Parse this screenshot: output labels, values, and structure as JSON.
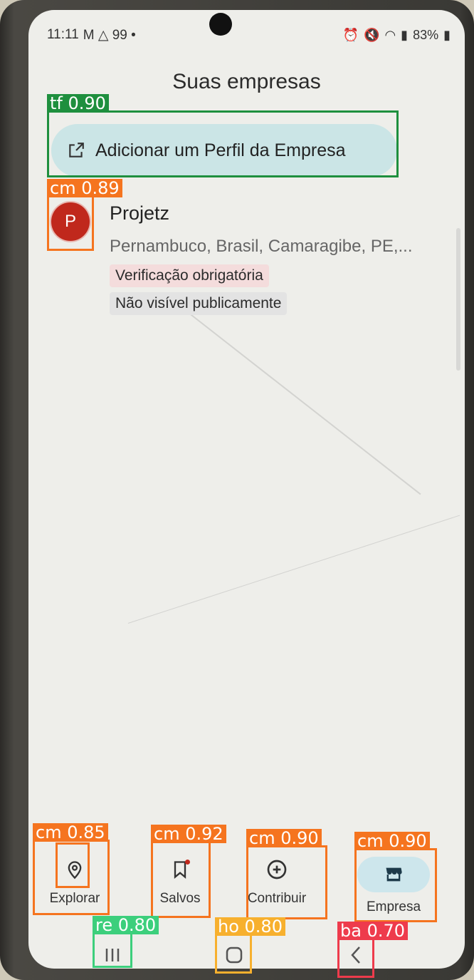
{
  "status_bar": {
    "time": "11:11",
    "left_icons": "M △ 99 •",
    "battery": "83%"
  },
  "page": {
    "title": "Suas empresas"
  },
  "add_profile_button": {
    "label": "Adicionar um Perfil da Empresa",
    "icon": "open-in-new-icon"
  },
  "business": {
    "avatar_letter": "P",
    "name": "Projetz",
    "address": "Pernambuco, Brasil, Camaragibe, PE,...",
    "chips": [
      "Verificação obrigatória",
      "Não visível publicamente"
    ]
  },
  "bottom_nav": {
    "items": [
      {
        "label": "Explorar",
        "icon": "location-pin-icon"
      },
      {
        "label": "Salvos",
        "icon": "bookmark-icon"
      },
      {
        "label": "Contribuir",
        "icon": "add-circle-icon"
      },
      {
        "label": "Empresa",
        "icon": "storefront-icon",
        "active": true
      }
    ]
  },
  "system_nav": {
    "buttons": [
      "recent-apps-icon",
      "home-icon",
      "back-icon"
    ]
  },
  "detections": [
    {
      "label": "tf 0.90",
      "color": "#1e8f3e"
    },
    {
      "label": "cm 0.89",
      "color": "#f5741f"
    },
    {
      "label": "cm 0.85",
      "color": "#f5741f"
    },
    {
      "label": "cm 0.92",
      "color": "#f5741f"
    },
    {
      "label": "cm 0.90",
      "color": "#f5741f"
    },
    {
      "label": "cm 0.90",
      "color": "#f5741f"
    },
    {
      "label": "re 0.80",
      "color": "#3ccf7c"
    },
    {
      "label": "ho 0.80",
      "color": "#f7b02e"
    },
    {
      "label": "ba 0.70",
      "color": "#ee3b4c"
    }
  ]
}
